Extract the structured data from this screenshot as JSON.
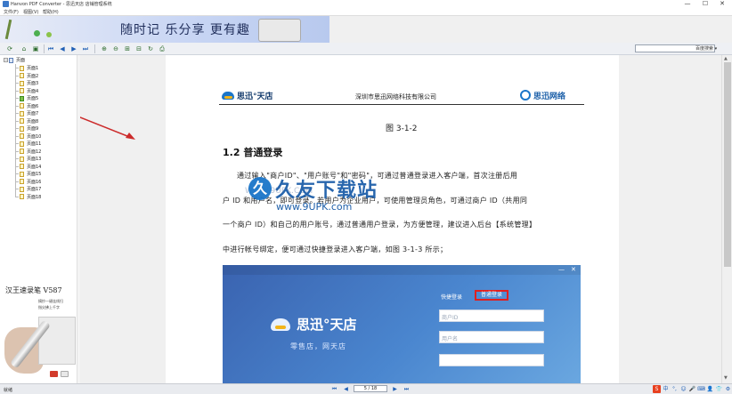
{
  "window": {
    "title": "Hanvon PDF Converter - 思迅天店 店铺管理系统",
    "controls": [
      "—",
      "☐",
      "✕"
    ]
  },
  "menu": [
    "文件(F)",
    "视图(V)",
    "帮助(H)"
  ],
  "banner": {
    "slogan": "随时记 乐分享 更有趣"
  },
  "toolbar": {
    "icons": [
      "refresh-icon",
      "open-icon",
      "save-icon",
      "first-page-icon",
      "prev-page-icon",
      "next-page-icon",
      "last-page-icon",
      "zoom-in-icon",
      "zoom-out-icon",
      "fit-page-icon",
      "fit-width-icon",
      "rotate-icon",
      "print-icon"
    ],
    "search_placeholder": "",
    "search_label": "百度搜索 ▾"
  },
  "tree": {
    "root": "页面",
    "pages": [
      "页面1",
      "页面2",
      "页面3",
      "页面4",
      "页面5",
      "页面6",
      "页面7",
      "页面8",
      "页面9",
      "页面10",
      "页面11",
      "页面12",
      "页面13",
      "页面14",
      "页面15",
      "页面16",
      "页面17",
      "页面18"
    ],
    "active_index": 4
  },
  "ad": {
    "title": "汉王速录笔 V587",
    "tag1": "摘抄一键连线扫",
    "tag2": "指尖拂上千字"
  },
  "document": {
    "company": "深圳市思迅网络科技有限公司",
    "logo_left": "思迅°天店",
    "logo_right": "思迅网络",
    "figure_caption": "图 3-1-2",
    "heading": "1.2 普通登录",
    "paragraph_lines": [
      "通过输入\"商户ID\"、\"用户账号\"和\"密码\"，可通过普通登录进入客户端，首次注册后用",
      "户 ID 和用户名，即可登录。若用户为企业用户，可使用管理员角色，可通过商户 ID（共用同",
      "一个商户 ID）和自己的用户账号，通过普通用户登录，为方便管理，建议进入后台【系统管理】",
      "中进行帐号绑定，便可通过快捷登录进入客户端，如图 3-1-3 所示；"
    ],
    "screenshot": {
      "window_controls": [
        "—",
        "✕"
      ],
      "brand": "思迅°天店",
      "brand_slogan": "零售店，网天店",
      "tab_quick": "快捷登录",
      "tab_normal": "普通登录",
      "field1": "商户ID",
      "field2": "用户名",
      "field3": ""
    }
  },
  "watermark": {
    "logo": "久",
    "text": "久友下载站",
    "url": "www.9UPK.com",
    "ghost": "WWW.9UPK.COM"
  },
  "statusbar": {
    "status": "就绪",
    "page_value": "5 / 18",
    "nav": [
      "⏮",
      "◀",
      "▶",
      "⏭"
    ]
  },
  "ime": {
    "logo": "S",
    "items": [
      "中",
      "°,",
      "☺",
      "🎤",
      "⌨",
      "👤",
      "👕",
      "⚙"
    ]
  }
}
